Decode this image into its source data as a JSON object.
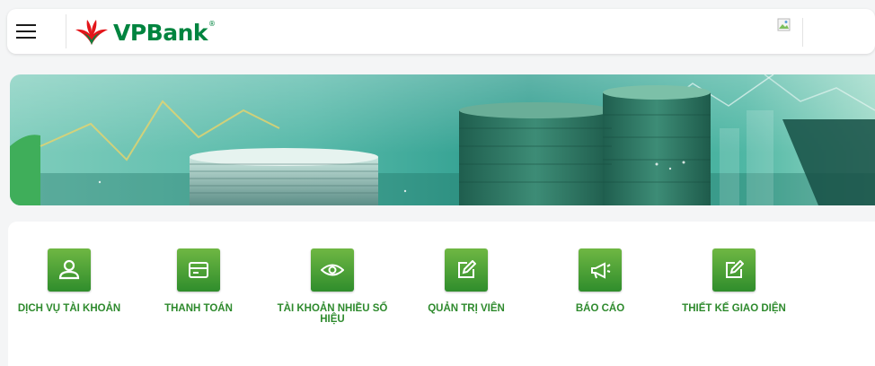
{
  "header": {
    "logo_text": "VPBank",
    "logo_mark": "®",
    "menu_icon": "hamburger-menu-icon",
    "avatar_icon": "broken-image-icon"
  },
  "banner": {
    "description_icon": "coins-finance-banner"
  },
  "colors": {
    "brand_green": "#00843f",
    "tile_green_top": "#6fb743",
    "tile_green_bottom": "#2f8d2c",
    "label_green": "#2e8a2d",
    "logo_red": "#e3151a"
  },
  "tiles": [
    {
      "label": "DỊCH VỤ TÀI KHOẢN",
      "icon": "user-icon"
    },
    {
      "label": "THANH TOÁN",
      "icon": "card-icon"
    },
    {
      "label": "TÀI KHOẢN NHIỀU SỐ HIỆU",
      "icon": "eye-icon"
    },
    {
      "label": "QUẢN TRỊ VIÊN",
      "icon": "edit-icon"
    },
    {
      "label": "BÁO CÁO",
      "icon": "megaphone-icon"
    },
    {
      "label": "THIẾT KẾ GIAO DIỆN",
      "icon": "edit-icon"
    }
  ]
}
